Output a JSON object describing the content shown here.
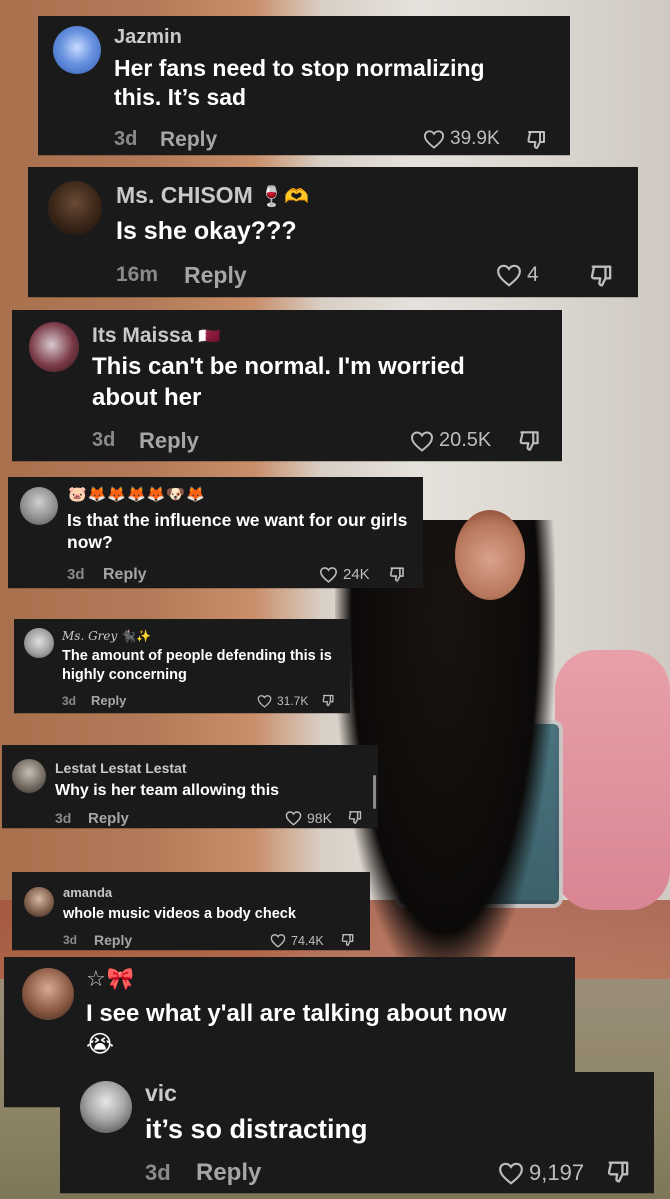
{
  "comments": [
    {
      "username": "Jazmin",
      "text": "Her fans need to stop normalizing this. It’s sad",
      "time": "3d",
      "reply_label": "Reply",
      "likes": "39.9K"
    },
    {
      "username": "Ms. CHISOM",
      "username_emoji": "🍷🫶",
      "text": "Is she okay???",
      "time": "16m",
      "reply_label": "Reply",
      "likes": "4"
    },
    {
      "username": "Its Maissa",
      "username_emoji": "🇶🇦",
      "text": "This can't be normal. I'm worried about her",
      "time": "3d",
      "reply_label": "Reply",
      "likes": "20.5K"
    },
    {
      "username": "🐷🦊🦊🦊🦊🐶🦊",
      "text": "Is that the influence we want for our girls now?",
      "time": "3d",
      "reply_label": "Reply",
      "likes": "24K"
    },
    {
      "username": "Ms. Grey",
      "username_emoji": "🐈‍⬛✨",
      "text": "The amount of people defending this is highly concerning",
      "time": "3d",
      "reply_label": "Reply",
      "likes": "31.7K"
    },
    {
      "username": "Lestat Lestat Lestat",
      "text": "Why is her team allowing this",
      "time": "3d",
      "reply_label": "Reply",
      "likes": "98K"
    },
    {
      "username": "amanda",
      "text": "whole music videos a body check",
      "time": "3d",
      "reply_label": "Reply",
      "likes": "74.4K"
    },
    {
      "username": "☆🎀",
      "text": "I see what y'all are talking about now",
      "text_emoji": "😭"
    },
    {
      "username": "vic",
      "text": "it’s so distracting",
      "time": "3d",
      "reply_label": "Reply",
      "likes": "9,197"
    }
  ],
  "icons": {
    "heart": "heart-icon",
    "dislike": "dislike-icon"
  },
  "colors": {
    "card_bg": "#1a1a1a",
    "username": "#c9c9c9",
    "meta": "#8a8a8a"
  }
}
